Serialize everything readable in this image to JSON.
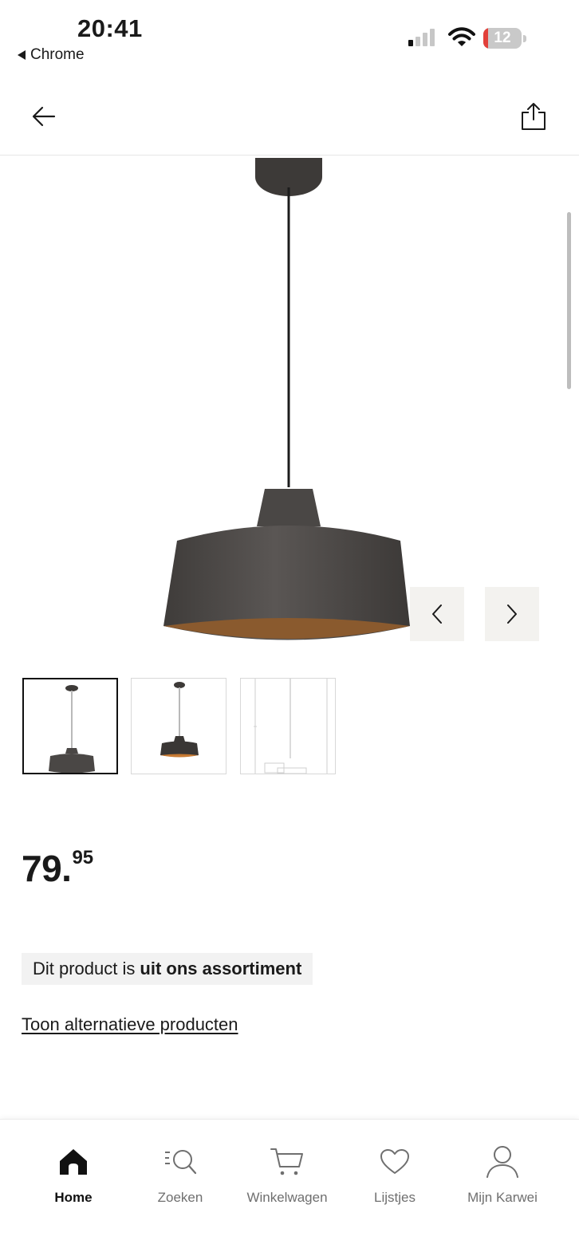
{
  "status_bar": {
    "time": "20:41",
    "back_app_label": "Chrome",
    "battery_level": "12",
    "battery_fraction": 0.12,
    "signal_bars_active": 1,
    "signal_bars_total": 4
  },
  "top_nav": {
    "back_icon": "arrow-left-icon",
    "share_icon": "share-icon"
  },
  "gallery": {
    "product_image": "pendant-lamp-image",
    "prev_icon": "chevron-left-icon",
    "next_icon": "chevron-right-icon",
    "active_thumbnail": 0,
    "thumbnails": [
      "pendant-lamp-thumbnail",
      "pendant-lamp-thumbnail",
      "lamp-dimension-drawing-thumbnail"
    ]
  },
  "product": {
    "price_main": "79.",
    "price_cents": "95",
    "notice_text": "Dit product is",
    "notice_bold": "uit ons assortiment",
    "alternatives_link": "Toon alternatieve producten"
  },
  "tab_bar": {
    "active_index": 0,
    "tabs": [
      {
        "label": "Home",
        "icon": "home-icon"
      },
      {
        "label": "Zoeken",
        "icon": "search-icon"
      },
      {
        "label": "Winkelwagen",
        "icon": "cart-icon"
      },
      {
        "label": "Lijstjes",
        "icon": "heart-icon"
      },
      {
        "label": "Mijn Karwei",
        "icon": "user-icon"
      }
    ]
  },
  "colors": {
    "lamp_shade": "#4a4745",
    "lamp_inner": "#8a5a2e",
    "arrow_button_bg": "#f3f2ef",
    "notice_bg": "#f2f2f2",
    "battery_low": "#e2403a"
  }
}
